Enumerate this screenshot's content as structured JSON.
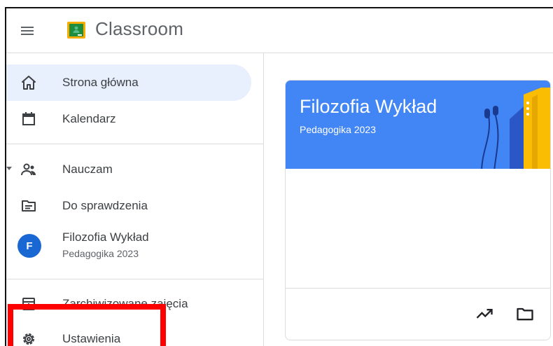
{
  "app": {
    "title": "Classroom",
    "brand_color": "#1e8e3e"
  },
  "sidebar": {
    "items": [
      {
        "label": "Strona główna",
        "icon": "home-icon",
        "active": true
      },
      {
        "label": "Kalendarz",
        "icon": "calendar-icon"
      },
      {
        "label": "Nauczam",
        "icon": "people-icon"
      },
      {
        "label": "Do sprawdzenia",
        "icon": "to-review-icon"
      },
      {
        "label": "Zarchiwizowane zajęcia",
        "icon": "archive-icon"
      },
      {
        "label": "Ustawienia",
        "icon": "gear-icon"
      }
    ],
    "class_entry": {
      "avatar_letter": "F",
      "name": "Filozofia Wykład",
      "section": "Pedagogika 2023",
      "avatar_color": "#1967d2"
    }
  },
  "course_card": {
    "title": "Filozofia Wykład",
    "section": "Pedagogika 2023",
    "banner_color": "#4285f4",
    "actions": [
      "trending-icon",
      "folder-icon"
    ]
  },
  "annotation": {
    "highlight_color": "#ff0000"
  }
}
